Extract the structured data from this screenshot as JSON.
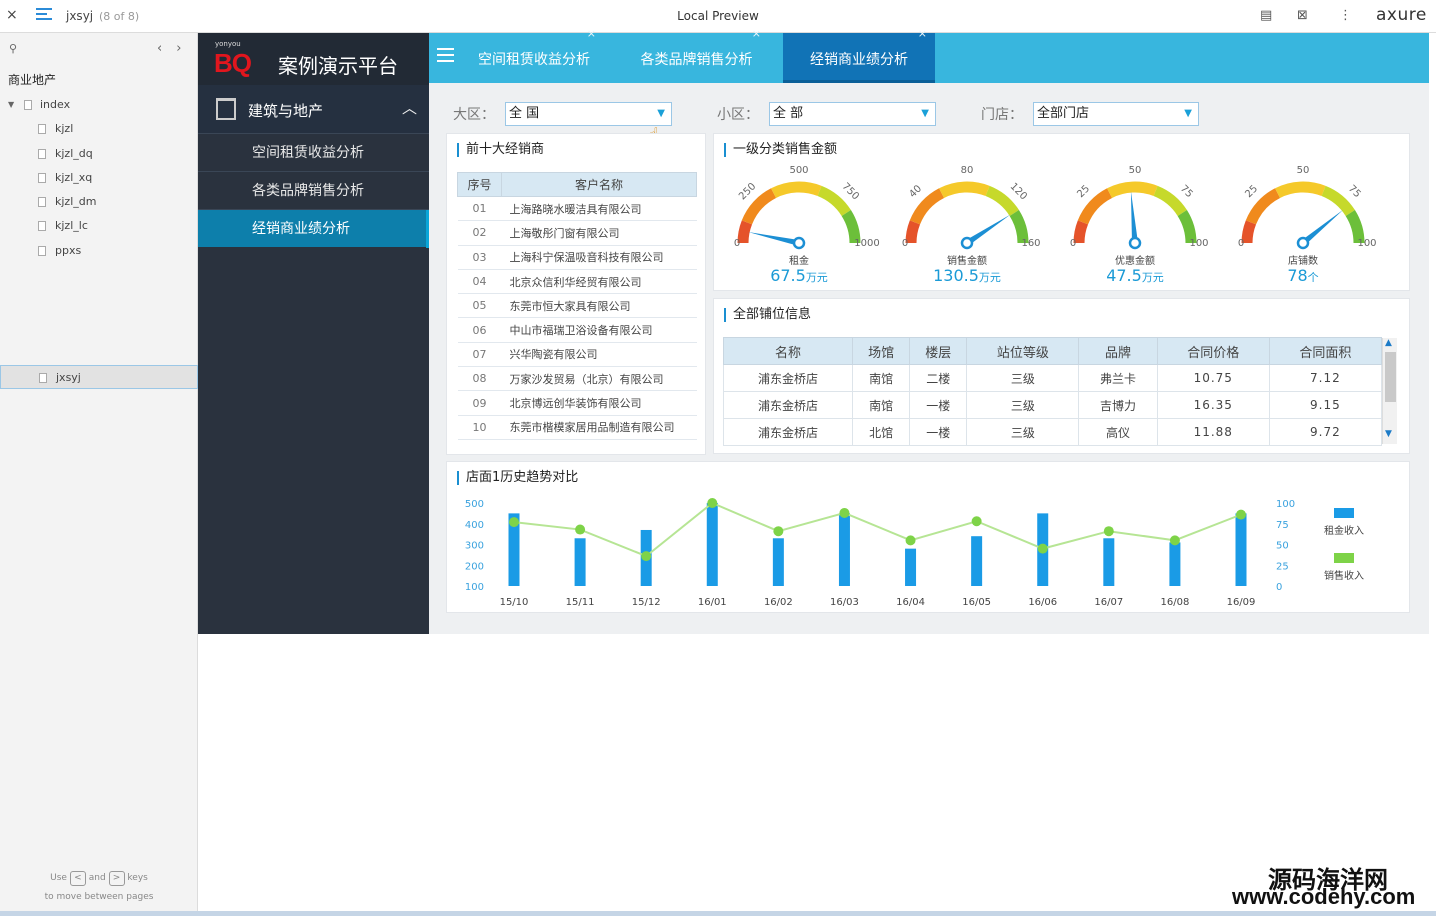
{
  "topbar": {
    "close": "×",
    "page_name": "jxsyj",
    "page_count": "(8 of 8)",
    "title": "Local Preview",
    "logo": "axure"
  },
  "sidebar": {
    "project": "商业地产",
    "items": [
      {
        "label": "index",
        "level": 0
      },
      {
        "label": "kjzl",
        "level": 1
      },
      {
        "label": "kjzl_dq",
        "level": 1
      },
      {
        "label": "kjzl_xq",
        "level": 1
      },
      {
        "label": "kjzl_dm",
        "level": 1
      },
      {
        "label": "kjzl_lc",
        "level": 1
      },
      {
        "label": "ppxs",
        "level": 1
      },
      {
        "label": "jxsyj",
        "level": 1,
        "selected": true
      }
    ],
    "hint_use": "Use",
    "hint_and": "and",
    "hint_keys": "keys",
    "hint_move": "to move between pages",
    "key_left": "<",
    "key_right": ">"
  },
  "brand": {
    "small": "yonyou",
    "logo": "BQ",
    "title": "案例演示平台"
  },
  "nav": {
    "group": "建筑与地产",
    "items": [
      "空间租赁收益分析",
      "各类品牌销售分析",
      "经销商业绩分析"
    ],
    "active": 2
  },
  "tabs": [
    {
      "label": "空间租赁收益分析"
    },
    {
      "label": "各类品牌销售分析"
    },
    {
      "label": "经销商业绩分析",
      "active": true
    }
  ],
  "filters": {
    "region_label": "大区：",
    "region_value": "全 国",
    "subregion_label": "小区：",
    "subregion_value": "全 部",
    "store_label": "门店：",
    "store_value": "全部门店"
  },
  "dealers": {
    "title": "前十大经销商",
    "headers": [
      "序号",
      "客户名称"
    ],
    "rows": [
      [
        "01",
        "上海路晓水暖洁具有限公司"
      ],
      [
        "02",
        "上海敬彤门窗有限公司"
      ],
      [
        "03",
        "上海科宁保温吸音科技有限公司"
      ],
      [
        "04",
        "北京众信利华经贸有限公司"
      ],
      [
        "05",
        "东莞市恒大家具有限公司"
      ],
      [
        "06",
        "中山市福瑞卫浴设备有限公司"
      ],
      [
        "07",
        "兴华陶瓷有限公司"
      ],
      [
        "08",
        "万家沙发贸易（北京）有限公司"
      ],
      [
        "09",
        "北京博远创华装饰有限公司"
      ],
      [
        "10",
        "东莞市楷模家居用品制造有限公司"
      ]
    ]
  },
  "gauges": {
    "title": "一级分类销售金额",
    "items": [
      {
        "label": "租金",
        "value": "67.5",
        "unit": "万元",
        "ticks": [
          "0",
          "250",
          "500",
          "750",
          "1000"
        ],
        "max": 1000,
        "v": 67.5
      },
      {
        "label": "销售金额",
        "value": "130.5",
        "unit": "万元",
        "ticks": [
          "0",
          "40",
          "80",
          "120",
          "160"
        ],
        "max": 160,
        "v": 130.5
      },
      {
        "label": "优惠金额",
        "value": "47.5",
        "unit": "万元",
        "ticks": [
          "0",
          "25",
          "50",
          "75",
          "100"
        ],
        "max": 100,
        "v": 47.5
      },
      {
        "label": "店铺数",
        "value": "78",
        "unit": "个",
        "ticks": [
          "0",
          "25",
          "50",
          "75",
          "100"
        ],
        "max": 100,
        "v": 78
      }
    ]
  },
  "shops": {
    "title": "全部铺位信息",
    "headers": [
      "名称",
      "场馆",
      "楼层",
      "站位等级",
      "品牌",
      "合同价格",
      "合同面积"
    ],
    "rows": [
      [
        "浦东金桥店",
        "南馆",
        "二楼",
        "三级",
        "弗兰卡",
        "10.75",
        "7.12"
      ],
      [
        "浦东金桥店",
        "南馆",
        "一楼",
        "三级",
        "吉博力",
        "16.35",
        "9.15"
      ],
      [
        "浦东金桥店",
        "北馆",
        "一楼",
        "三级",
        "高仪",
        "11.88",
        "9.72"
      ]
    ]
  },
  "chart_data": {
    "type": "bar",
    "title": "店面1历史趋势对比",
    "categories": [
      "15/10",
      "15/11",
      "15/12",
      "16/01",
      "16/02",
      "16/03",
      "16/04",
      "16/05",
      "16/06",
      "16/07",
      "16/08",
      "16/09"
    ],
    "y_left_ticks": [
      "500",
      "400",
      "300",
      "200",
      "100"
    ],
    "y_right_ticks": [
      "100",
      "75",
      "50",
      "25",
      "0"
    ],
    "ylim_left": [
      100,
      500
    ],
    "ylim_right": [
      0,
      100
    ],
    "series": [
      {
        "name": "租金收入",
        "type": "bar",
        "axis": "left",
        "color": "#1a9be6",
        "values": [
          450,
          330,
          370,
          500,
          330,
          450,
          280,
          340,
          450,
          330,
          310,
          450
        ]
      },
      {
        "name": "销售收入",
        "type": "line",
        "axis": "right",
        "color": "#7ed348",
        "values": [
          77,
          68,
          36,
          100,
          66,
          88,
          55,
          78,
          45,
          66,
          55,
          86
        ]
      }
    ]
  },
  "watermark": {
    "line1": "源码海洋网",
    "line2": "www.codehy.com"
  }
}
